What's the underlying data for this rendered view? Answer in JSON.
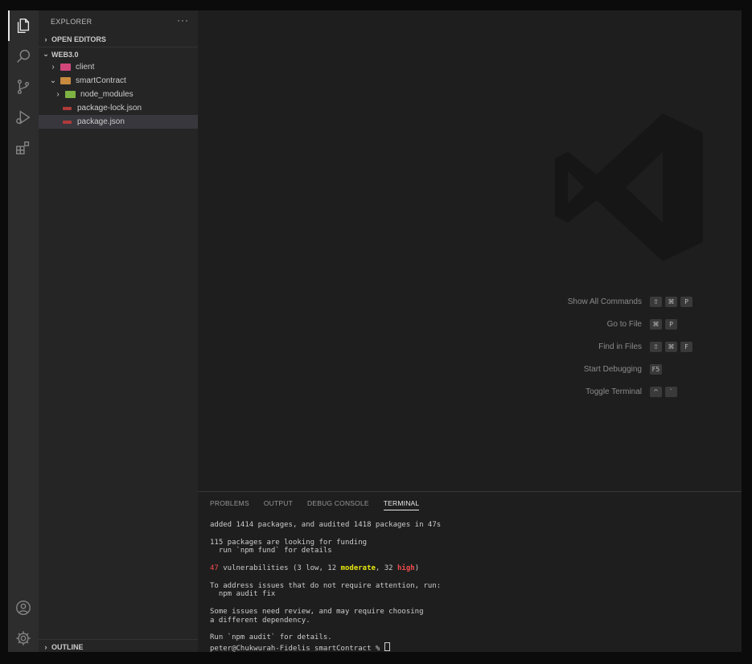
{
  "sidebar": {
    "title": "EXPLORER",
    "more": "···",
    "open_editors": "OPEN EDITORS",
    "workspace": "WEB3.0",
    "outline": "OUTLINE",
    "tree": [
      {
        "label": "client",
        "indent": 1,
        "kind": "folder",
        "chevron": "›",
        "color": "#d1477a"
      },
      {
        "label": "smartContract",
        "indent": 1,
        "kind": "folder-open",
        "chevron": "⌄",
        "color": "#c88a3e"
      },
      {
        "label": "node_modules",
        "indent": 2,
        "kind": "folder",
        "chevron": "›",
        "color": "#7cb342"
      },
      {
        "label": "package-lock.json",
        "indent": 2,
        "kind": "file",
        "chevron": "",
        "color": "#b03a3a"
      },
      {
        "label": "package.json",
        "indent": 2,
        "kind": "file",
        "chevron": "",
        "color": "#b03a3a"
      }
    ]
  },
  "editor": {
    "commands": [
      {
        "label": "Show All Commands",
        "keys": [
          "⇧",
          "⌘",
          "P"
        ]
      },
      {
        "label": "Go to File",
        "keys": [
          "⌘",
          "P"
        ]
      },
      {
        "label": "Find in Files",
        "keys": [
          "⇧",
          "⌘",
          "F"
        ]
      },
      {
        "label": "Start Debugging",
        "keys": [
          "F5"
        ]
      },
      {
        "label": "Toggle Terminal",
        "keys": [
          "^",
          "`"
        ]
      }
    ]
  },
  "panel": {
    "tabs": [
      "PROBLEMS",
      "OUTPUT",
      "DEBUG CONSOLE",
      "TERMINAL"
    ],
    "active_tab": "TERMINAL",
    "terminal": {
      "added": "added 1414 packages, and audited 1418 packages in 47s",
      "funding_1": "115 packages are looking for funding",
      "funding_2": "  run `npm fund` for details",
      "vuln_count": "47",
      "vuln_text": " vulnerabilities (3 low, 12 ",
      "vuln_moderate": "moderate",
      "vuln_sep": ", 32 ",
      "vuln_high": "high",
      "vuln_end": ")",
      "address_1": "To address issues that do not require attention, run:",
      "address_2": "  npm audit fix",
      "review_1": "Some issues need review, and may require choosing",
      "review_2": "a different dependency.",
      "run_audit": "Run `npm audit` for details.",
      "prompt": "peter@Chukwurah-Fidelis smartContract % "
    }
  },
  "colors": {
    "background": "#1e1e1e",
    "sidebar": "#252526",
    "activity_bar": "#2d2d2d",
    "selected_row": "#37373d",
    "error_red": "#f14c4c",
    "warning_yellow": "#e5e510"
  }
}
